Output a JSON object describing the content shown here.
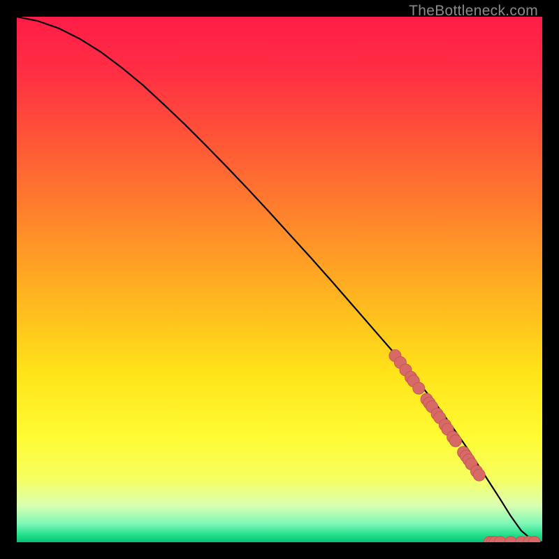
{
  "watermark": "TheBottleneck.com",
  "colors": {
    "gradient_stops": [
      {
        "offset": 0.0,
        "color": "#ff1d47"
      },
      {
        "offset": 0.1,
        "color": "#ff2d44"
      },
      {
        "offset": 0.25,
        "color": "#ff5a36"
      },
      {
        "offset": 0.4,
        "color": "#ff8a2a"
      },
      {
        "offset": 0.55,
        "color": "#ffba1e"
      },
      {
        "offset": 0.68,
        "color": "#ffe41a"
      },
      {
        "offset": 0.8,
        "color": "#fffb33"
      },
      {
        "offset": 0.88,
        "color": "#f6ff61"
      },
      {
        "offset": 0.93,
        "color": "#daffb3"
      },
      {
        "offset": 0.965,
        "color": "#7cf7b6"
      },
      {
        "offset": 0.985,
        "color": "#26e28e"
      },
      {
        "offset": 1.0,
        "color": "#06c275"
      }
    ],
    "curve": "#000000",
    "marker_fill": "#d76a67",
    "marker_stroke": "#c75652"
  },
  "chart_data": {
    "type": "line",
    "title": "",
    "xlabel": "",
    "ylabel": "",
    "xlim": [
      0,
      100
    ],
    "ylim": [
      0,
      100
    ],
    "grid": false,
    "series": [
      {
        "name": "bottleneck-curve",
        "x": [
          0,
          4,
          8,
          12,
          16,
          20,
          24,
          28,
          32,
          36,
          40,
          44,
          48,
          52,
          56,
          60,
          64,
          68,
          72,
          76,
          80,
          83,
          86,
          88,
          90,
          92,
          94,
          96,
          98,
          100
        ],
        "y": [
          100,
          99.2,
          97.8,
          95.8,
          93.3,
          90.3,
          87.0,
          83.3,
          79.5,
          75.5,
          71.4,
          67.2,
          62.9,
          58.5,
          54.1,
          49.6,
          45.0,
          40.4,
          35.8,
          31.0,
          26.0,
          21.8,
          17.5,
          14.4,
          11.3,
          8.2,
          5.0,
          2.2,
          0.5,
          0.0
        ]
      },
      {
        "name": "highlighted-points",
        "x": [
          72,
          73,
          74,
          75,
          75.5,
          76.5,
          78,
          78.5,
          79,
          80,
          80.5,
          81.5,
          82,
          83,
          83.5,
          85,
          85.5,
          86,
          86.5,
          87.5,
          88,
          90,
          90.5,
          91,
          92,
          94,
          96,
          97.5,
          98.5
        ],
        "y": [
          35.5,
          34.2,
          32.8,
          31.4,
          30.7,
          29.3,
          27.2,
          26.5,
          25.8,
          24.4,
          23.7,
          22.3,
          21.5,
          20.0,
          19.3,
          17.1,
          16.4,
          15.7,
          14.9,
          13.5,
          12.8,
          0.0,
          0.0,
          0.0,
          0.0,
          0.0,
          0.0,
          0.0,
          0.0
        ]
      }
    ]
  }
}
